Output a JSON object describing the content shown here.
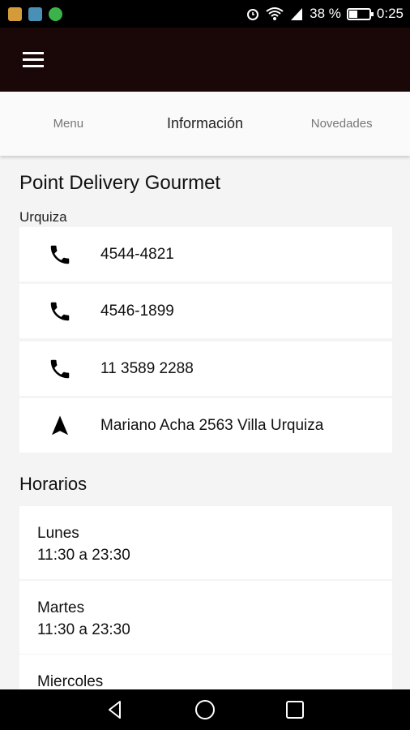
{
  "status_bar": {
    "battery_percent": "38 %",
    "battery_level": 0.38,
    "time": "0:25"
  },
  "colors": {
    "app_bar": "#1a0707",
    "notif_1": "#d49b3a",
    "notif_2": "#4a8fb5",
    "notif_3": "#3bb34a"
  },
  "tabs": [
    {
      "label": "Menu"
    },
    {
      "label": "Información"
    },
    {
      "label": "Novedades"
    }
  ],
  "info": {
    "title": "Point Delivery Gourmet",
    "subtitle": "Urquiza",
    "contacts": [
      {
        "icon": "phone-icon",
        "text": "4544-4821"
      },
      {
        "icon": "phone-icon",
        "text": "4546-1899"
      },
      {
        "icon": "phone-icon",
        "text": "11 3589 2288"
      },
      {
        "icon": "navigation-arrow-icon",
        "text": "Mariano Acha 2563 Villa Urquiza"
      }
    ]
  },
  "hours": {
    "title": "Horarios",
    "days": [
      {
        "day": "Lunes",
        "time": "11:30 a 23:30"
      },
      {
        "day": "Martes",
        "time": "11:30 a 23:30"
      },
      {
        "day": "Miercoles",
        "time": ""
      }
    ]
  }
}
